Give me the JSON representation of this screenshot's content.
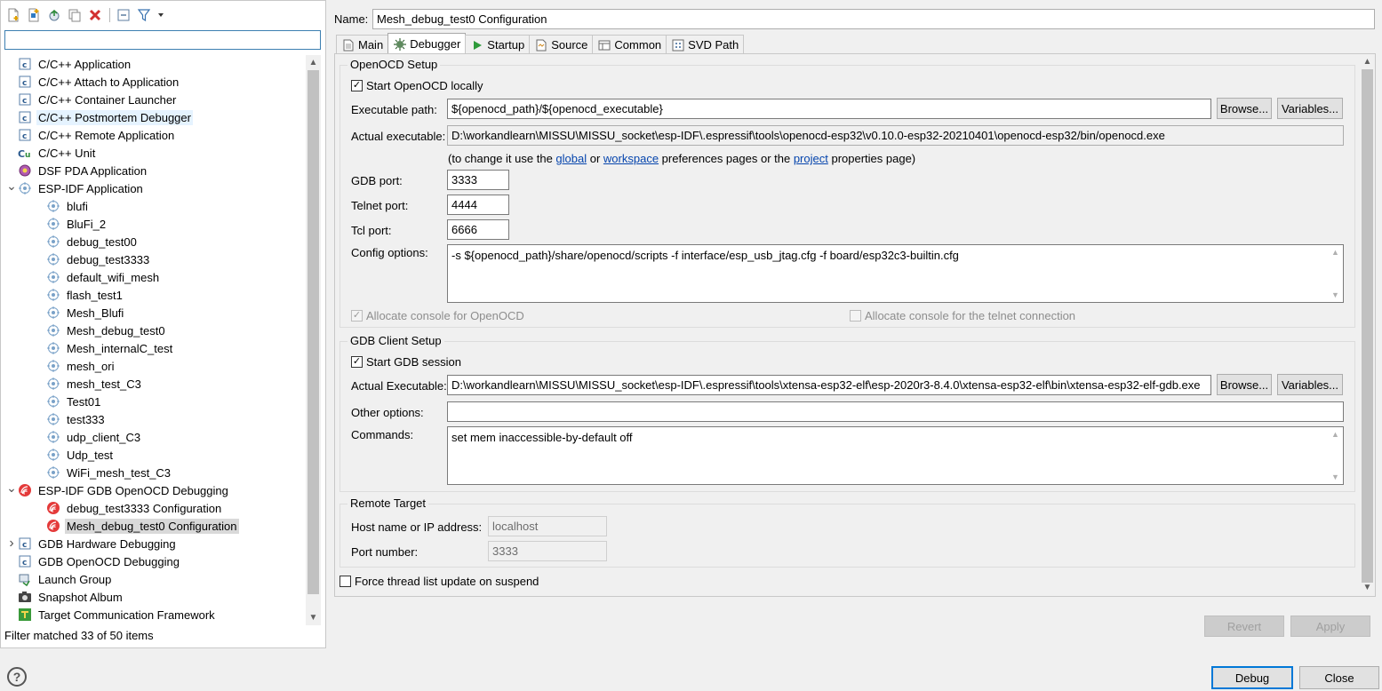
{
  "sidebar": {
    "filter_value": "",
    "status": "Filter matched 33 of 50 items",
    "items": [
      {
        "label": "C/C++ Application",
        "icon": "c-file-icon",
        "depth": 0,
        "twisty": ""
      },
      {
        "label": "C/C++ Attach to Application",
        "icon": "c-file-icon",
        "depth": 0,
        "twisty": ""
      },
      {
        "label": "C/C++ Container Launcher",
        "icon": "c-file-icon",
        "depth": 0,
        "twisty": ""
      },
      {
        "label": "C/C++ Postmortem Debugger",
        "icon": "c-file-icon",
        "depth": 0,
        "twisty": "",
        "state": "hover"
      },
      {
        "label": "C/C++ Remote Application",
        "icon": "c-file-icon",
        "depth": 0,
        "twisty": ""
      },
      {
        "label": "C/C++ Unit",
        "icon": "unit-test-icon",
        "depth": 0,
        "twisty": ""
      },
      {
        "label": "DSF PDA Application",
        "icon": "gear-icon",
        "depth": 0,
        "twisty": ""
      },
      {
        "label": "ESP-IDF Application",
        "icon": "target-icon",
        "depth": 0,
        "twisty": "expanded"
      },
      {
        "label": "blufi",
        "icon": "target-icon",
        "depth": 1,
        "twisty": ""
      },
      {
        "label": "BluFi_2",
        "icon": "target-icon",
        "depth": 1,
        "twisty": ""
      },
      {
        "label": "debug_test00",
        "icon": "target-icon",
        "depth": 1,
        "twisty": ""
      },
      {
        "label": "debug_test3333",
        "icon": "target-icon",
        "depth": 1,
        "twisty": ""
      },
      {
        "label": "default_wifi_mesh",
        "icon": "target-icon",
        "depth": 1,
        "twisty": ""
      },
      {
        "label": "flash_test1",
        "icon": "target-icon",
        "depth": 1,
        "twisty": ""
      },
      {
        "label": "Mesh_Blufi",
        "icon": "target-icon",
        "depth": 1,
        "twisty": ""
      },
      {
        "label": "Mesh_debug_test0",
        "icon": "target-icon",
        "depth": 1,
        "twisty": ""
      },
      {
        "label": "Mesh_internalC_test",
        "icon": "target-icon",
        "depth": 1,
        "twisty": ""
      },
      {
        "label": "mesh_ori",
        "icon": "target-icon",
        "depth": 1,
        "twisty": ""
      },
      {
        "label": "mesh_test_C3",
        "icon": "target-icon",
        "depth": 1,
        "twisty": ""
      },
      {
        "label": "Test01",
        "icon": "target-icon",
        "depth": 1,
        "twisty": ""
      },
      {
        "label": "test333",
        "icon": "target-icon",
        "depth": 1,
        "twisty": ""
      },
      {
        "label": "udp_client_C3",
        "icon": "target-icon",
        "depth": 1,
        "twisty": ""
      },
      {
        "label": "Udp_test",
        "icon": "target-icon",
        "depth": 1,
        "twisty": ""
      },
      {
        "label": "WiFi_mesh_test_C3",
        "icon": "target-icon",
        "depth": 1,
        "twisty": ""
      },
      {
        "label": "ESP-IDF GDB OpenOCD Debugging",
        "icon": "espressif-icon",
        "depth": 0,
        "twisty": "expanded"
      },
      {
        "label": "debug_test3333 Configuration",
        "icon": "espressif-icon",
        "depth": 1,
        "twisty": ""
      },
      {
        "label": "Mesh_debug_test0 Configuration",
        "icon": "espressif-icon",
        "depth": 1,
        "twisty": "",
        "state": "selected"
      },
      {
        "label": "GDB Hardware Debugging",
        "icon": "c-file-icon",
        "depth": 0,
        "twisty": "collapsed"
      },
      {
        "label": "GDB OpenOCD Debugging",
        "icon": "c-file-icon",
        "depth": 0,
        "twisty": ""
      },
      {
        "label": "Launch Group",
        "icon": "launch-group-icon",
        "depth": 0,
        "twisty": ""
      },
      {
        "label": "Snapshot Album",
        "icon": "camera-icon",
        "depth": 0,
        "twisty": ""
      },
      {
        "label": "Target Communication Framework",
        "icon": "tcf-icon",
        "depth": 0,
        "twisty": ""
      }
    ]
  },
  "config": {
    "name_label": "Name:",
    "name_value": "Mesh_debug_test0 Configuration"
  },
  "tabs": [
    {
      "label": "Main",
      "icon": "document-icon"
    },
    {
      "label": "Debugger",
      "icon": "bug-icon",
      "active": true
    },
    {
      "label": "Startup",
      "icon": "play-icon"
    },
    {
      "label": "Source",
      "icon": "source-icon"
    },
    {
      "label": "Common",
      "icon": "common-icon"
    },
    {
      "label": "SVD Path",
      "icon": "svd-icon"
    }
  ],
  "openocd": {
    "legend": "OpenOCD Setup",
    "start_locally": "Start OpenOCD locally",
    "exec_path_label": "Executable path:",
    "exec_path_value": "${openocd_path}/${openocd_executable}",
    "actual_exec_label": "Actual executable:",
    "actual_exec_value": "D:\\workandlearn\\MISSU\\MISSU_socket\\esp-IDF\\.espressif\\tools\\openocd-esp32\\v0.10.0-esp32-20210401\\openocd-esp32/bin/openocd.exe",
    "hint_prefix": "(to change it use the ",
    "hint_global": "global",
    "hint_or": " or ",
    "hint_workspace": "workspace",
    "hint_middle": " preferences pages or the ",
    "hint_project": "project",
    "hint_suffix": " properties page)",
    "gdb_port_label": "GDB port:",
    "gdb_port_value": "3333",
    "telnet_port_label": "Telnet port:",
    "telnet_port_value": "4444",
    "tcl_port_label": "Tcl port:",
    "tcl_port_value": "6666",
    "config_options_label": "Config options:",
    "config_options_value": "-s ${openocd_path}/share/openocd/scripts -f interface/esp_usb_jtag.cfg -f board/esp32c3-builtin.cfg",
    "alloc_console": "Allocate console for OpenOCD",
    "alloc_telnet": "Allocate console for the telnet connection"
  },
  "gdb_client": {
    "legend": "GDB Client Setup",
    "start_session": "Start GDB session",
    "actual_exec_label": "Actual Executable:",
    "actual_exec_value": "D:\\workandlearn\\MISSU\\MISSU_socket\\esp-IDF\\.espressif\\tools\\xtensa-esp32-elf\\esp-2020r3-8.4.0\\xtensa-esp32-elf\\bin\\xtensa-esp32-elf-gdb.exe",
    "other_options_label": "Other options:",
    "other_options_value": "",
    "commands_label": "Commands:",
    "commands_value": "set mem inaccessible-by-default off"
  },
  "remote_target": {
    "legend": "Remote Target",
    "host_label": "Host name or IP address:",
    "host_value": "localhost",
    "port_label": "Port number:",
    "port_value": "3333"
  },
  "force_thread": "Force thread list update on suspend",
  "buttons": {
    "browse": "Browse...",
    "variables": "Variables...",
    "revert": "Revert",
    "apply": "Apply",
    "debug": "Debug",
    "close": "Close"
  },
  "colors": {
    "accent": "#0078d7",
    "selection": "#d9d9d9",
    "link": "#0645ad"
  }
}
